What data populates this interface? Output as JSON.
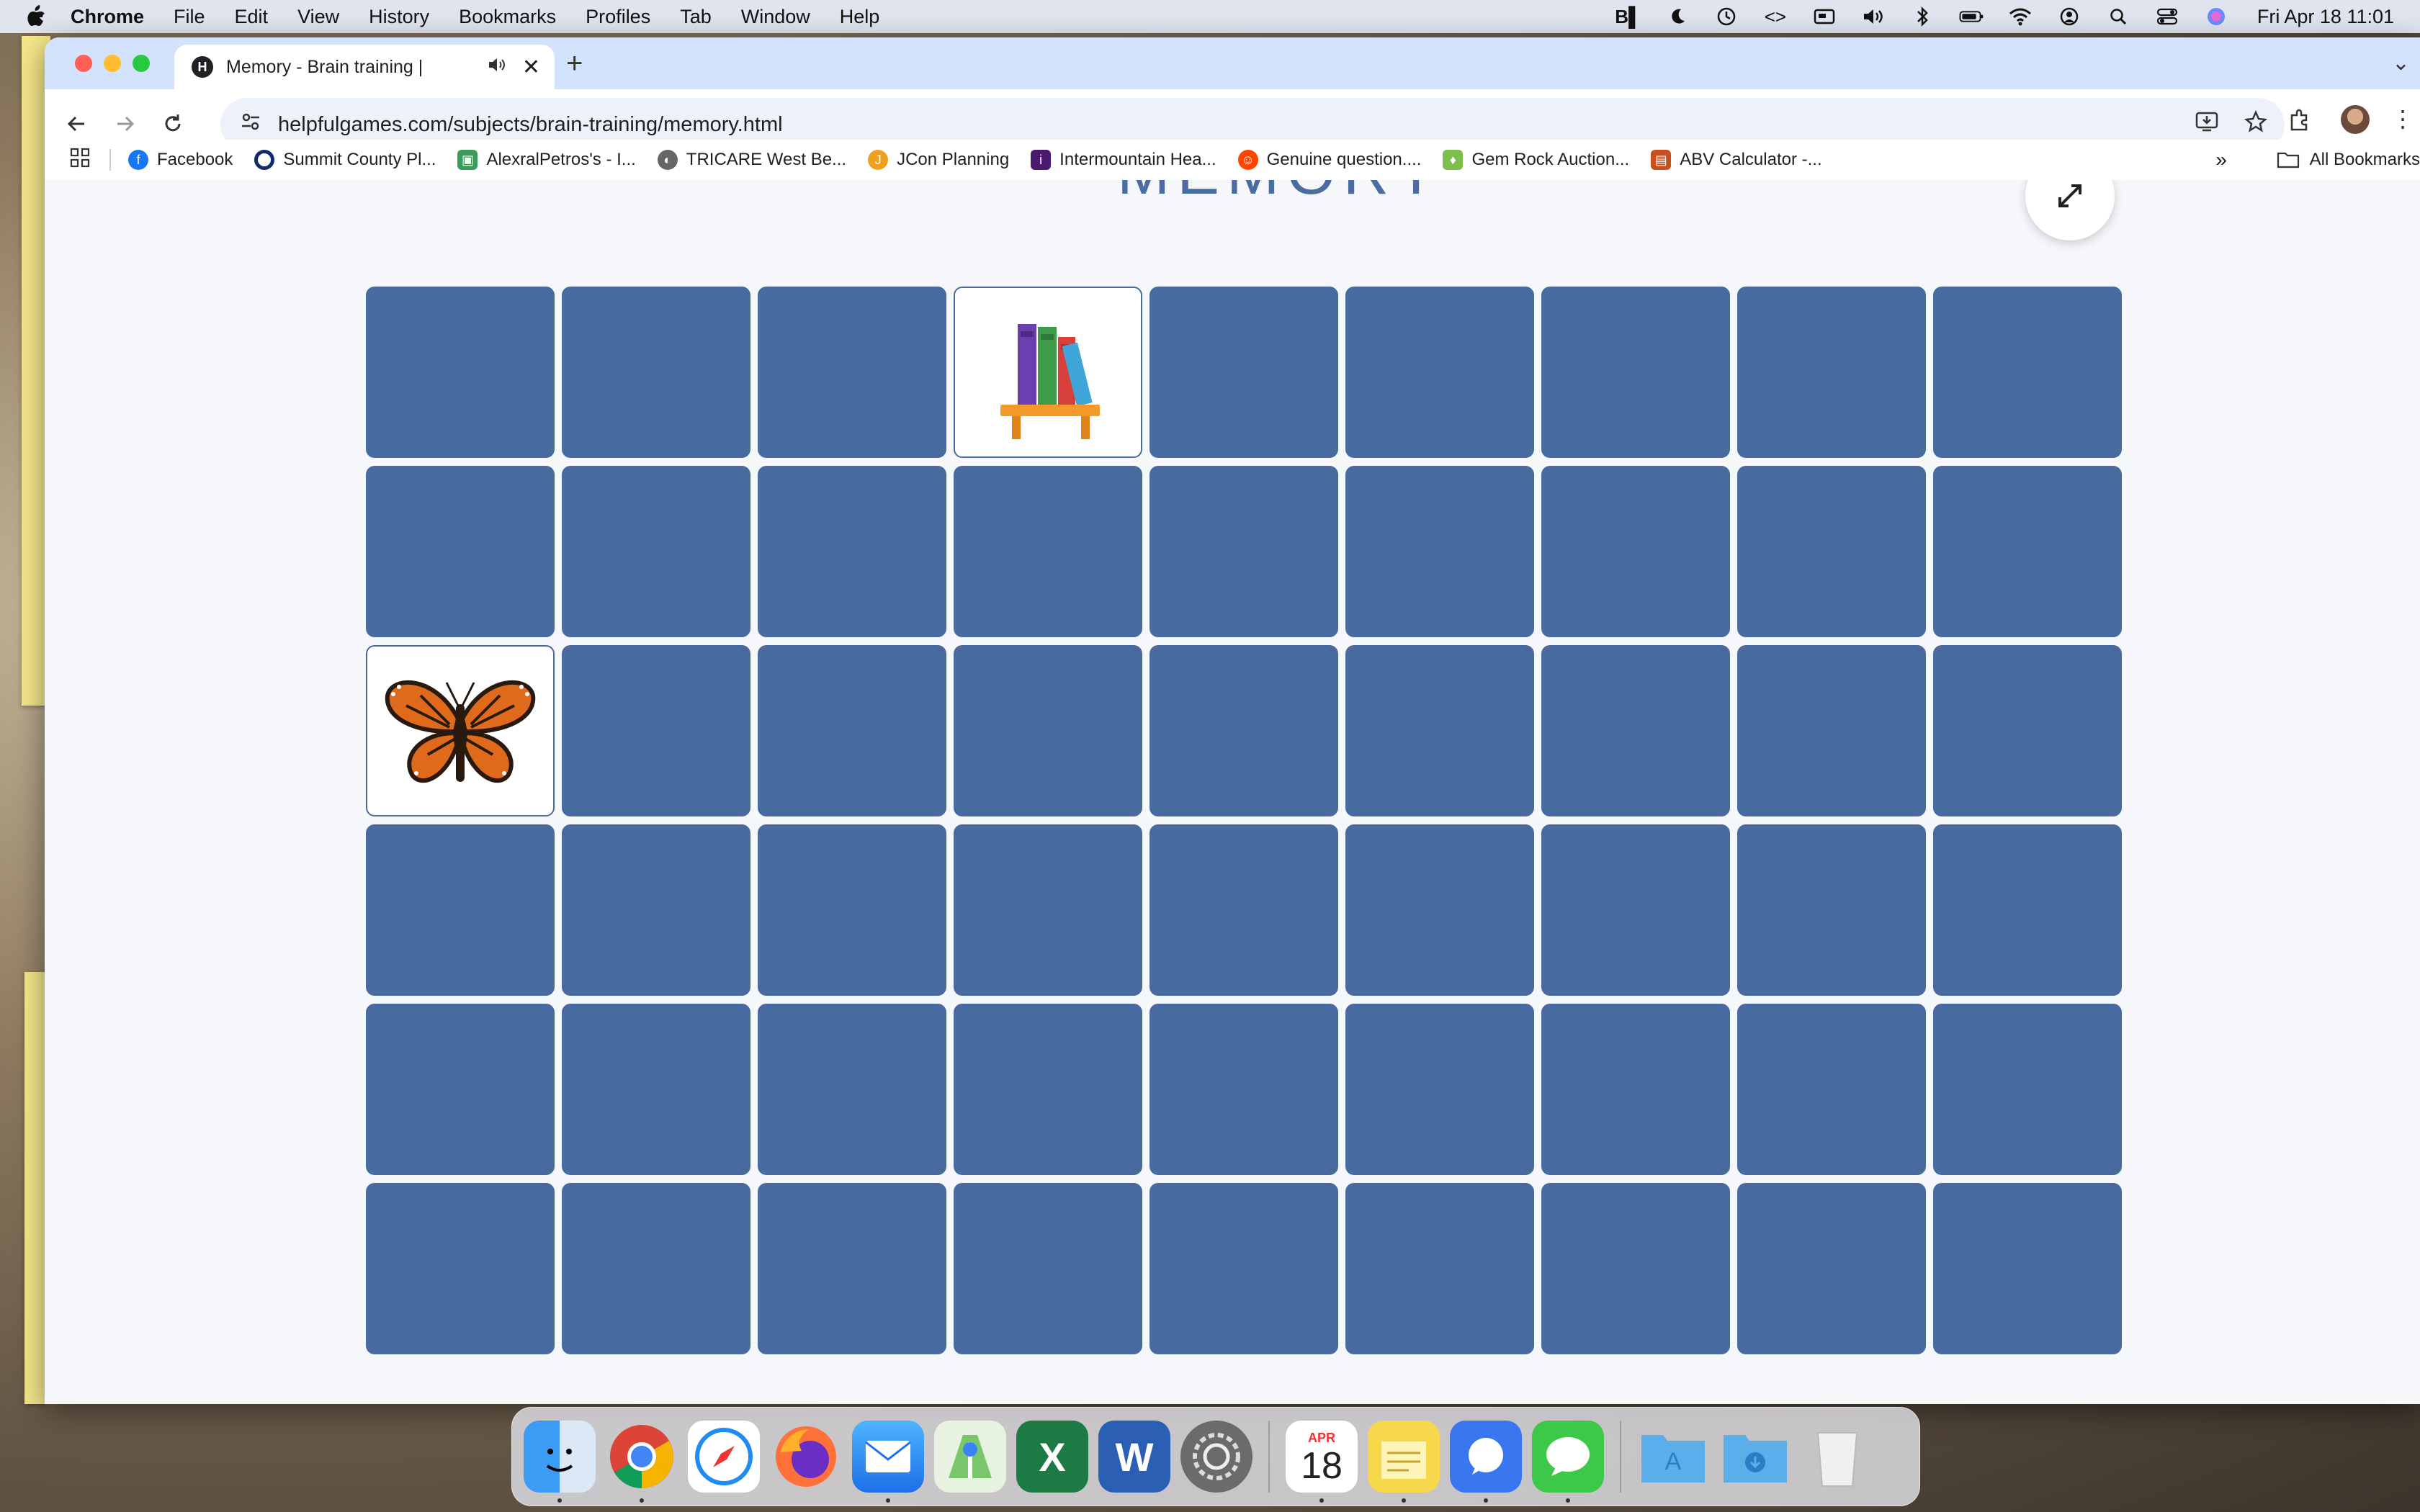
{
  "menubar": {
    "items": [
      "Chrome",
      "File",
      "Edit",
      "View",
      "History",
      "Bookmarks",
      "Profiles",
      "Tab",
      "Window",
      "Help"
    ],
    "clock": "Fri Apr 18  11:01"
  },
  "tab": {
    "title": "Memory - Brain training |"
  },
  "omnibox": {
    "url": "helpfulgames.com/subjects/brain-training/memory.html"
  },
  "bookmarks": {
    "items": [
      "Facebook",
      "Summit County Pl...",
      "AlexralPetros's - I...",
      "TRICARE West Be...",
      "JCon Planning",
      "Intermountain Hea...",
      "Genuine question....",
      "Gem Rock Auction...",
      "ABV Calculator -..."
    ],
    "all_label": "All Bookmarks"
  },
  "game": {
    "title": "MEMORY",
    "columns": 9,
    "rows": 6,
    "face_up_cards": [
      {
        "row": 1,
        "col": 4,
        "icon": "bookshelf-icon"
      },
      {
        "row": 3,
        "col": 1,
        "icon": "butterfly-icon"
      }
    ],
    "card_back_color": "#486b9f"
  },
  "dock": {
    "calendar_month": "APR",
    "calendar_day": "18",
    "apps": [
      "finder",
      "chrome",
      "safari",
      "firefox",
      "mail",
      "maps",
      "excel",
      "word",
      "system-settings",
      "calendar",
      "notes",
      "signal",
      "messages",
      "applications-folder",
      "downloads-folder",
      "trash"
    ]
  },
  "colors": {
    "accent": "#486b9f",
    "tabstrip": "#d3e3fd"
  }
}
